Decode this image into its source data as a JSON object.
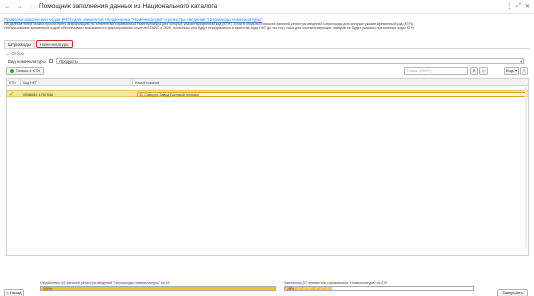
{
  "window": {
    "title": "Помощник заполнения данных из Национального каталога",
    "back_glyph": "←",
    "forward_glyph": "→",
    "star_glyph": "☆",
    "controls": [
      "⋮",
      "⤢",
      "✕"
    ]
  },
  "header": {
    "link": "Проверка заполнения кодов (КТН) для элементов справочника \"Номенклатура\" и регистра сведений \"Штрихкоды номенклатуры\"",
    "description_lines": [
      "На данном этапе можно просмотреть информацию по элементам справочника Номенклатура для которых указан временный код (КТН). Если в открытых списках записей регистра сведений Штрихкоды для которых указан временный код (КТН).",
      "Использование временных кодов обеспечивает возможность формирования отчетов ЕГАИС и ЭСФ, поскольку они будут передаваться в качестве кода НКТ до тех пор, пока для соответствующих товаров не будут указаны постоянные коды КТН."
    ]
  },
  "tabs": [
    {
      "label": "Штрихкоды",
      "active": false
    },
    {
      "label": "Номенклатура",
      "active": true
    }
  ],
  "group": {
    "label": "Отбор",
    "chevron": "⌄"
  },
  "filter": {
    "label": "Вид номенклатуры",
    "value": "Продукты",
    "arrow": "▾"
  },
  "toolbar": {
    "only_ktn": "Только с КТН",
    "search_placeholder": "Поиск (Ctrl+F)",
    "search_glyph": "⌕",
    "clear_glyph": "✕",
    "more": "Еще ▾",
    "help": "?"
  },
  "grid": {
    "columns": [
      "КТН",
      "Код НКТ",
      "Наименование"
    ],
    "rows": [
      {
        "ktn_checked": true,
        "code": "0008662-1787338",
        "name": "00 Самсунг Завод Бытовой техники"
      }
    ],
    "check_glyph": "✔",
    "ellipsis": "…"
  },
  "status": {
    "left_label": "Обработано 63 записей регистра сведений \"Штрихкоды номенклатуры\" из 63",
    "left_percent_text": "100%",
    "left_progress": 1.0,
    "right_label": "Заполнено 67 элементов справочника \"Номенклатура\" из 270",
    "right_percent_text": "25%",
    "right_progress": 0.25,
    "back_button": "< Назад",
    "finish_button": "Завершить"
  },
  "colors": {
    "accent_link": "#4a7bb7",
    "row_highlight": "#f9e3a1",
    "progress": "#f6c21d",
    "active_tab_border": "#d9262f"
  }
}
